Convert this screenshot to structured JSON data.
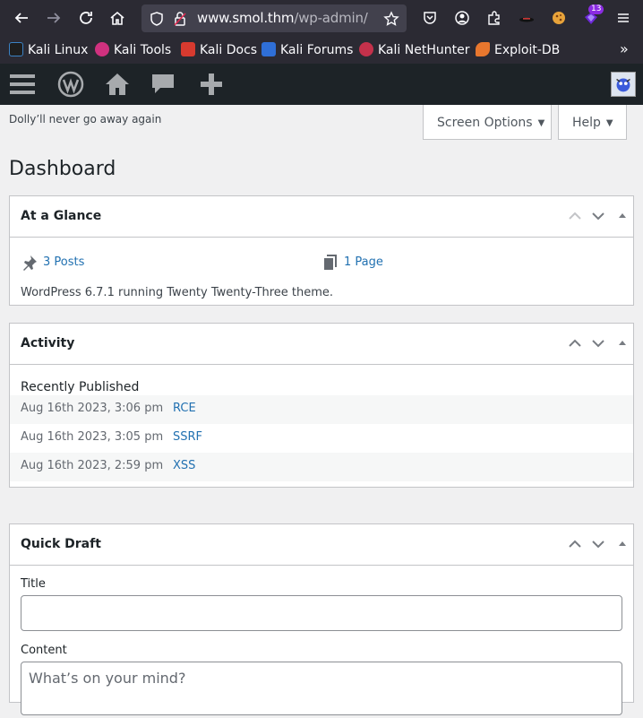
{
  "browser": {
    "url_host": "www.smol.thm",
    "url_path": "/wp-admin/",
    "extension_badge": "13",
    "bookmarks": [
      {
        "label": "Kali Linux",
        "color": "#3b82c4"
      },
      {
        "label": "Kali Tools",
        "color": "#d0317f"
      },
      {
        "label": "Kali Docs",
        "color": "#d73a2f"
      },
      {
        "label": "Kali Forums",
        "color": "#2f6fd7"
      },
      {
        "label": "Kali NetHunter",
        "color": "#c4314b"
      },
      {
        "label": "Exploit-DB",
        "color": "#e8772e"
      }
    ]
  },
  "wp": {
    "dolly": "Dolly’ll never go away again",
    "screen_options": "Screen Options",
    "help": "Help",
    "page_title": "Dashboard",
    "glance": {
      "title": "At a Glance",
      "posts": "3 Posts",
      "pages": "1 Page",
      "version": "WordPress 6.7.1 running Twenty Twenty-Three theme."
    },
    "activity": {
      "title": "Activity",
      "recently": "Recently Published",
      "items": [
        {
          "date": "Aug 16th 2023, 3:06 pm",
          "title": "RCE"
        },
        {
          "date": "Aug 16th 2023, 3:05 pm",
          "title": "SSRF"
        },
        {
          "date": "Aug 16th 2023, 2:59 pm",
          "title": "XSS"
        }
      ]
    },
    "quick_draft": {
      "title": "Quick Draft",
      "title_label": "Title",
      "title_value": "",
      "content_label": "Content",
      "content_placeholder": "What’s on your mind?"
    }
  }
}
